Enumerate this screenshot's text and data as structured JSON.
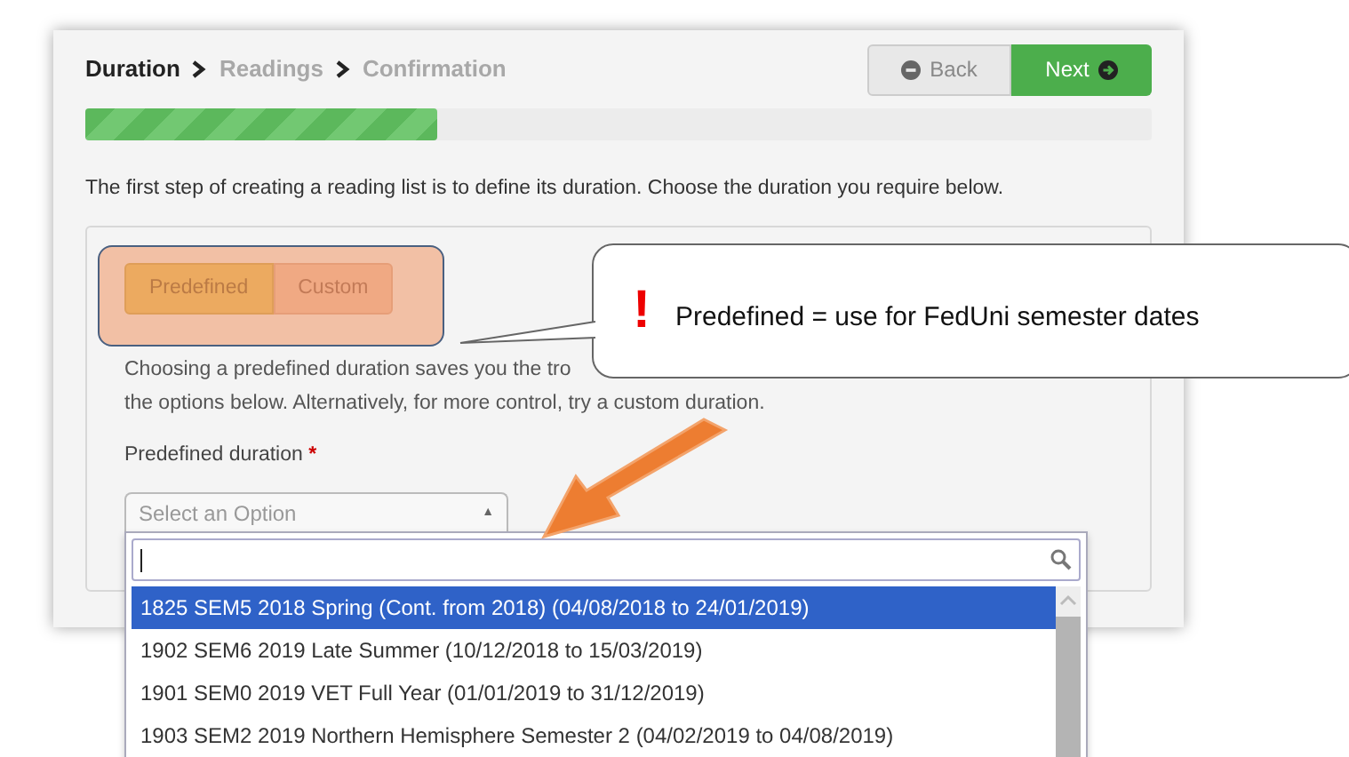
{
  "steps": [
    {
      "label": "Duration",
      "selected": true
    },
    {
      "label": "Readings",
      "selected": false
    },
    {
      "label": "Confirmation",
      "selected": false
    }
  ],
  "buttons": {
    "back": "Back",
    "next": "Next"
  },
  "progress": {
    "level": 0.33
  },
  "intro": "The first step of creating a reading list is to define its duration. Choose the duration you require below.",
  "toggle": [
    {
      "label": "Predefined",
      "selected": true
    },
    {
      "label": "Custom",
      "selected": false
    }
  ],
  "description": [
    "Choosing a predefined duration saves you the tro",
    "the options below. Alternatively, for more control, try a custom duration."
  ],
  "field": {
    "label": "Predefined duration",
    "required_mark": "*",
    "placeholder": "Select an Option",
    "expanded": true,
    "caret": "▲"
  },
  "dropdown": {
    "options": [
      {
        "label": "1825 SEM5 2018 Spring (Cont. from 2018) (04/08/2018 to 24/01/2019)",
        "selected": true
      },
      {
        "label": "1902 SEM6 2019 Late Summer (10/12/2018 to 15/03/2019)",
        "selected": false
      },
      {
        "label": "1901 SEM0 2019 VET Full Year (01/01/2019 to 31/12/2019)",
        "selected": false
      },
      {
        "label": "1903 SEM2 2019 Northern Hemisphere Semester 2 (04/02/2019 to 04/08/2019)",
        "selected": false
      }
    ]
  },
  "callout": {
    "mark": "!",
    "text": "Predefined = use for FedUni semester dates"
  }
}
